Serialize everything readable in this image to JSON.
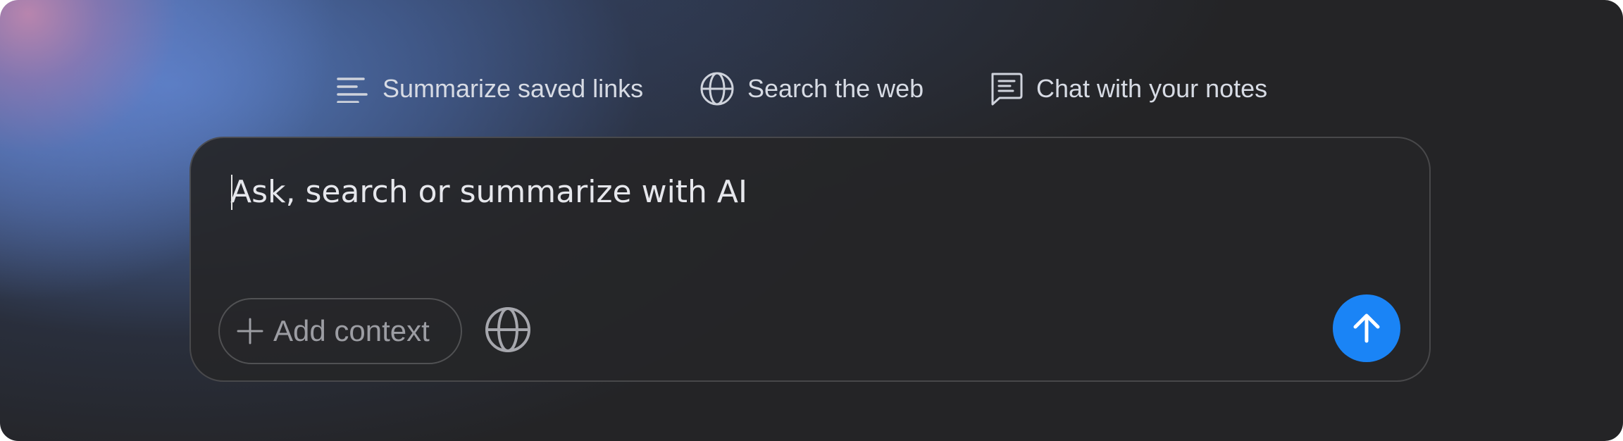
{
  "suggestions": [
    {
      "label": "Summarize saved links",
      "icon": "lines-icon"
    },
    {
      "label": "Search the web",
      "icon": "globe-icon"
    },
    {
      "label": "Chat with your notes",
      "icon": "chat-note-icon"
    }
  ],
  "composer": {
    "placeholder": "Ask, search or summarize with AI",
    "add_context_label": "Add context",
    "add_icon": "plus-icon",
    "web_icon": "globe-icon",
    "send_icon": "arrow-up-icon"
  },
  "colors": {
    "accent": "#1a84f6",
    "panel": "#262628",
    "text": "#d7dbe4"
  }
}
